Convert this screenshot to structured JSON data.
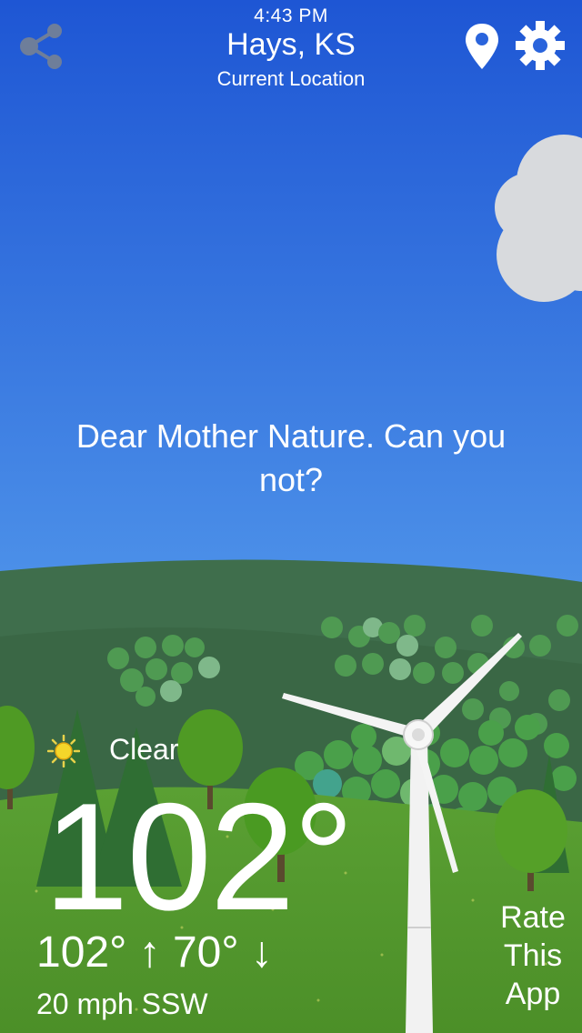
{
  "header": {
    "time": "4:43 PM",
    "city": "Hays, KS",
    "sublocation": "Current Location",
    "icons": [
      "share-icon",
      "location-pin-icon",
      "gear-icon"
    ]
  },
  "message": "Dear Mother Nature. Can you not?",
  "weather": {
    "condition_icon": "sun-icon",
    "condition": "Clear",
    "temperature": "102°",
    "high": "102°",
    "high_arrow": "↑",
    "low": "70°",
    "low_arrow": "↓",
    "wind": "20 mph SSW"
  },
  "rate": {
    "line1": "Rate",
    "line2": "This",
    "line3": "App"
  },
  "colors": {
    "sky_top": "#1f5bd6",
    "sky_bottom": "#5a9fee",
    "hill": "#3d6b4a",
    "grass": "#5a9a2e",
    "cloud": "#d6d8dc"
  }
}
